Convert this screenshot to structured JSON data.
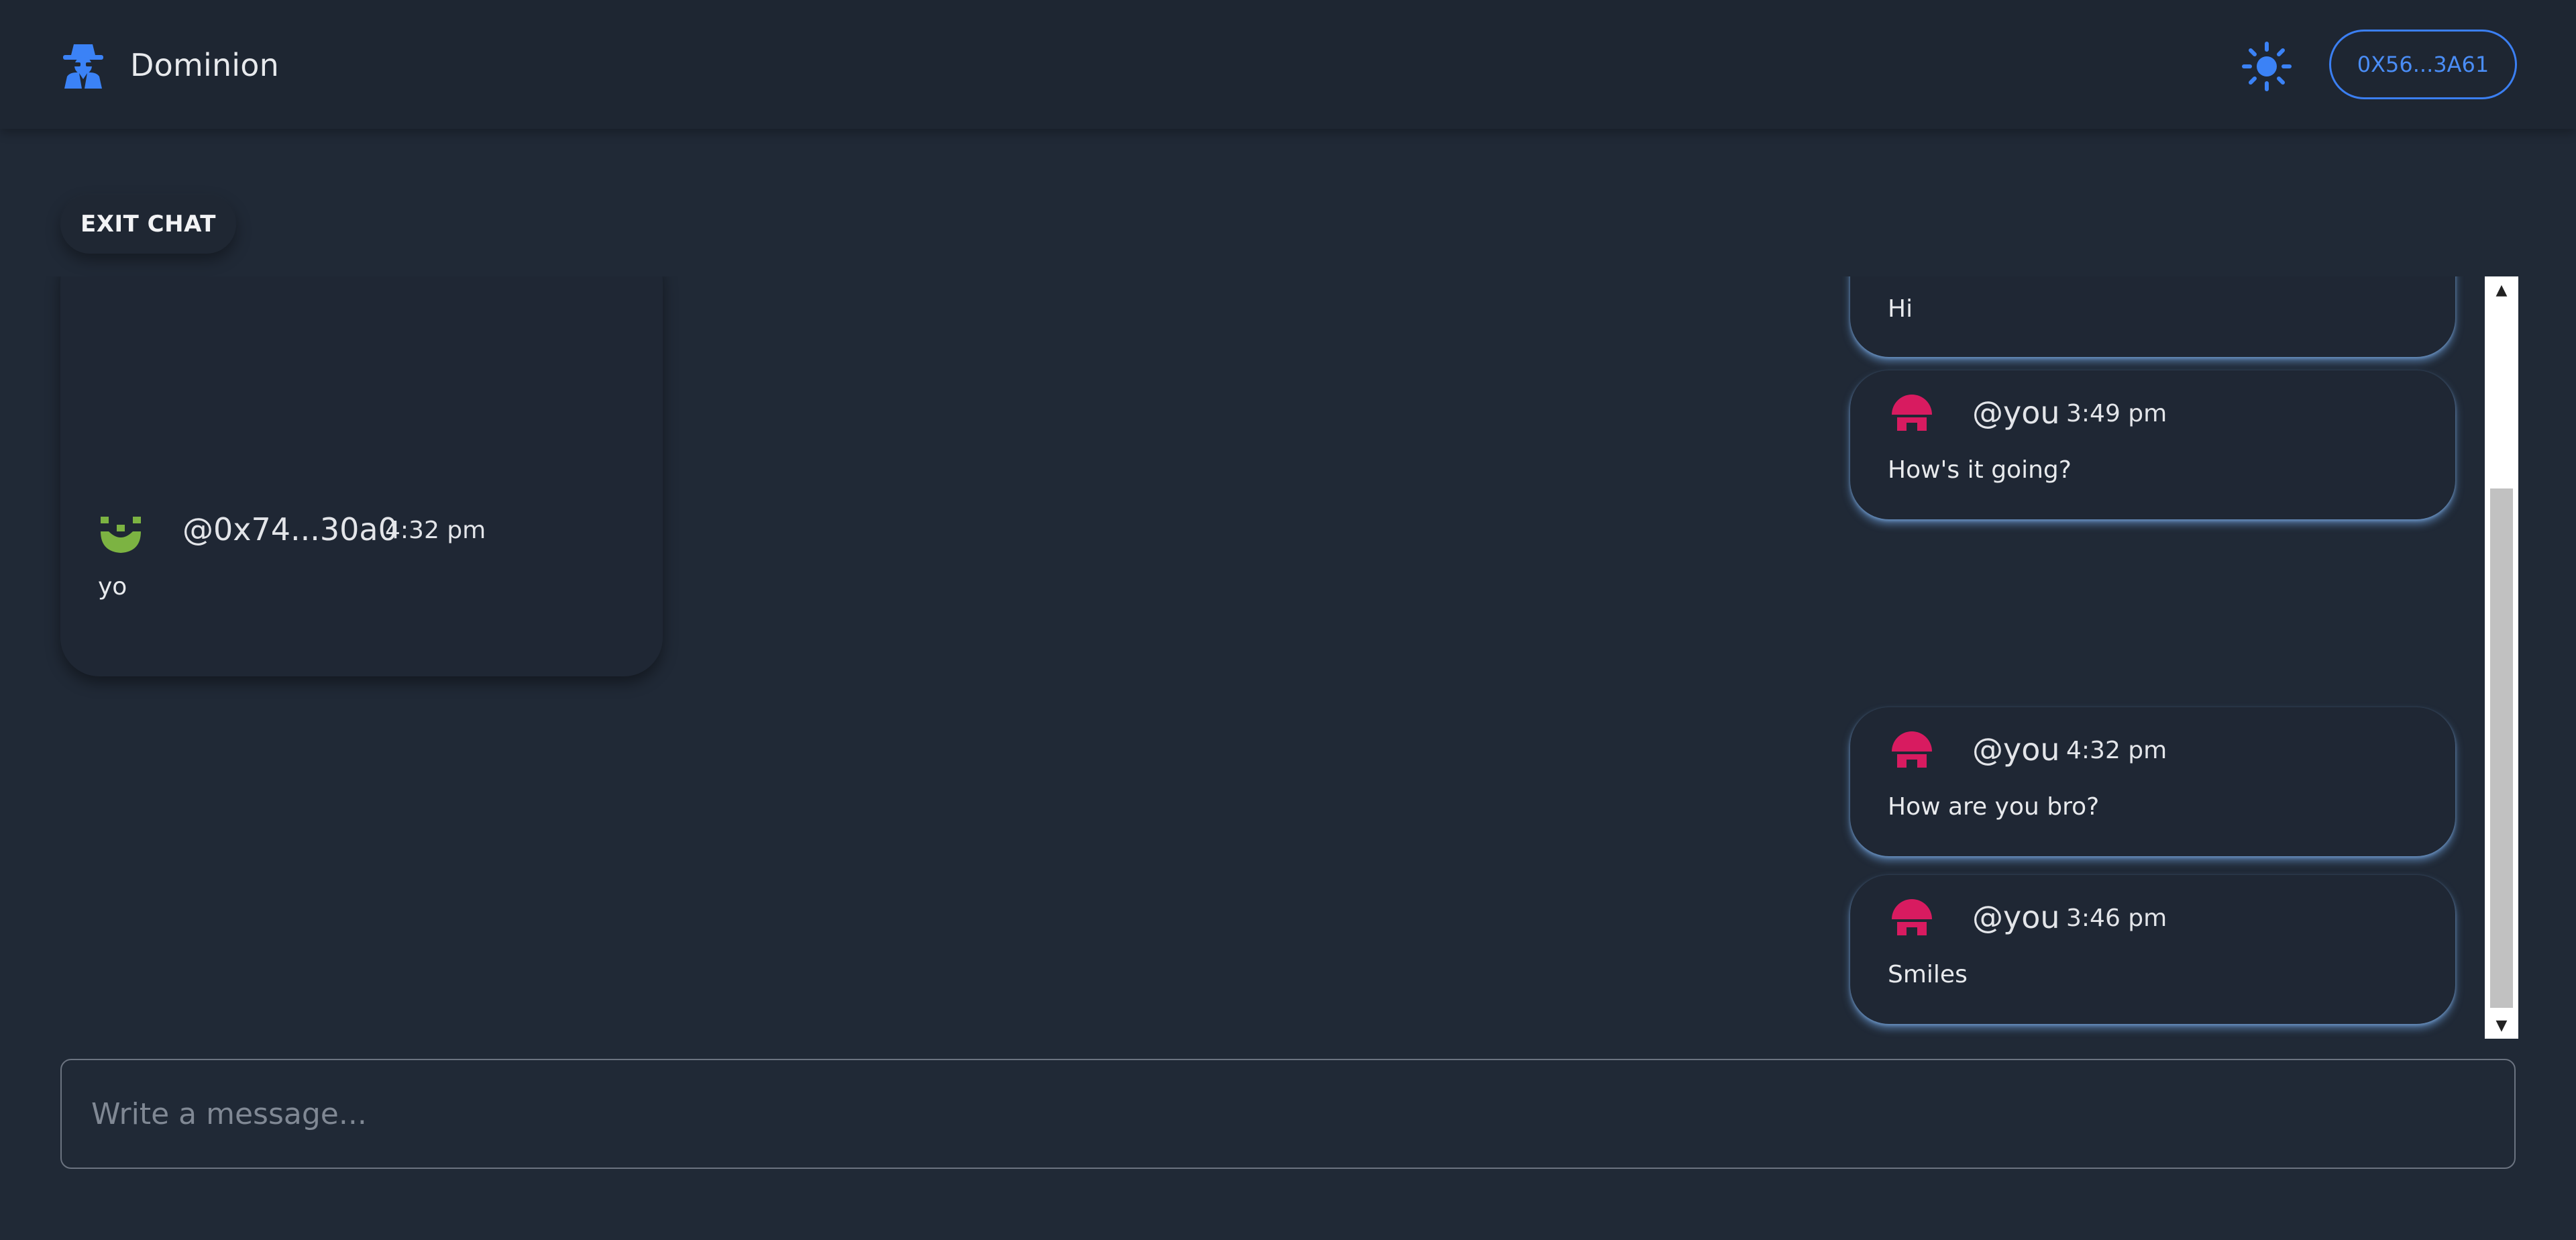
{
  "header": {
    "app_name": "Dominion",
    "wallet_label": "0X56...3A61",
    "brand_icon": "spy-icon",
    "theme_icon": "sun-icon"
  },
  "chat": {
    "exit_label": "EXIT CHAT",
    "messages": [
      {
        "sender": "",
        "time": "",
        "text": "Hi",
        "own": true
      },
      {
        "sender": "@you",
        "time": "3:49 pm",
        "text": "How's it going?",
        "own": true
      },
      {
        "sender": "@0x74...30a0",
        "time": "4:32 pm",
        "text": "yo",
        "own": false
      },
      {
        "sender": "@you",
        "time": "4:32 pm",
        "text": "How are you bro?",
        "own": true
      },
      {
        "sender": "@you",
        "time": "3:46 pm",
        "text": "Smiles",
        "own": true
      }
    ]
  },
  "composer": {
    "placeholder": "Write a message...",
    "value": ""
  },
  "colors": {
    "background": "#202936",
    "accent": "#3b7ff2",
    "own_avatar": "#d81b60",
    "other_avatar": "#7cb342",
    "own_bubble_glow": "#78aff0"
  }
}
